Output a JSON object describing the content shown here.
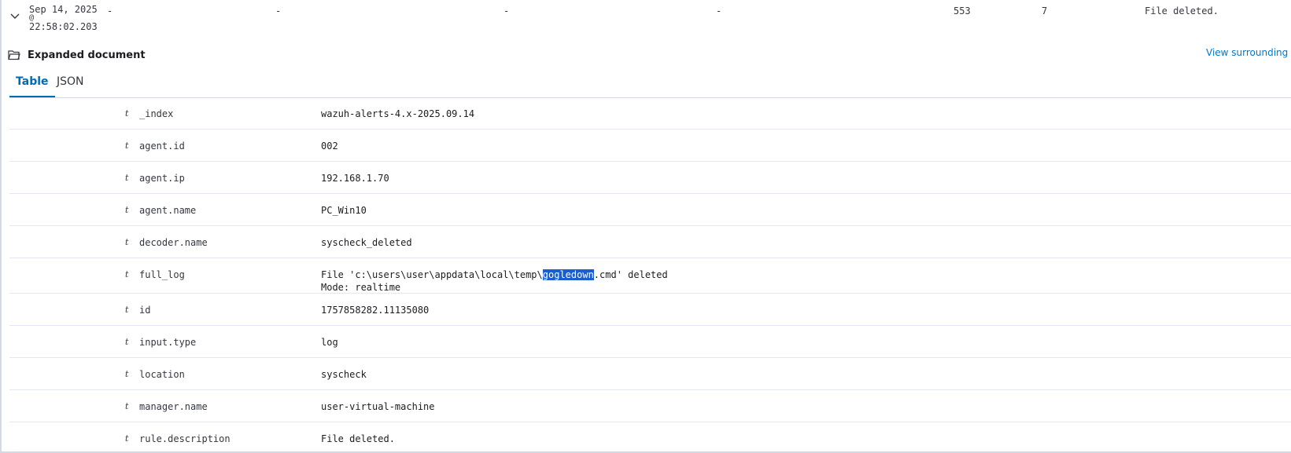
{
  "summary_row": {
    "date": "Sep 14, 2025",
    "at": "@",
    "time": "22:58:02.203",
    "col1": "-",
    "col2": "-",
    "col3": "-",
    "col4": "-",
    "col5": "553",
    "col6": "7",
    "col7": "File deleted."
  },
  "expanded": {
    "title": "Expanded document",
    "view_link": "View surrounding"
  },
  "tabs": [
    {
      "label": "Table",
      "active": true
    },
    {
      "label": "JSON",
      "active": false
    }
  ],
  "field_type_icon": "t",
  "fields": [
    {
      "name": "_index",
      "value": "wazuh-alerts-4.x-2025.09.14"
    },
    {
      "name": "agent.id",
      "value": "002"
    },
    {
      "name": "agent.ip",
      "value": "192.168.1.70"
    },
    {
      "name": "agent.name",
      "value": "PC_Win10"
    },
    {
      "name": "decoder.name",
      "value": "syscheck_deleted"
    },
    {
      "name": "full_log",
      "value_pre": "File 'c:\\users\\user\\appdata\\local\\temp\\",
      "value_highlight": "gogledown",
      "value_post": ".cmd' deleted",
      "value_line2": "Mode: realtime"
    },
    {
      "name": "id",
      "value": "1757858282.11135080"
    },
    {
      "name": "input.type",
      "value": "log"
    },
    {
      "name": "location",
      "value": "syscheck"
    },
    {
      "name": "manager.name",
      "value": "user-virtual-machine"
    },
    {
      "name": "rule.description",
      "value": "File deleted."
    }
  ],
  "colors": {
    "accent": "#006bb4",
    "link": "#0077cc",
    "highlight": "#1a5fd0"
  }
}
